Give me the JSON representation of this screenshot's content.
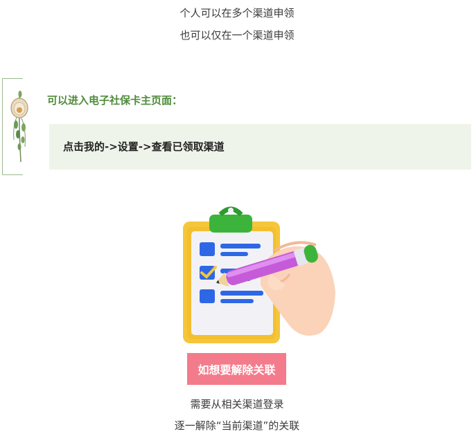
{
  "intro": {
    "line1": "个人可以在多个渠道申领",
    "line2": "也可以仅在一个渠道申领"
  },
  "section": {
    "title": "可以进入电子社保卡主页面：",
    "tip": "点击我的->设置->查看已领取渠道"
  },
  "cta": {
    "label": "如想要解除关联"
  },
  "footer": {
    "line1": "需要从相关渠道登录",
    "line2": "逐一解除“当前渠道”的关联"
  },
  "colors": {
    "accent_green": "#4f8b3b",
    "tip_background": "#eef4ea",
    "badge_pink": "#f47b8b"
  },
  "icons": {
    "decoration": "herb-bundle-icon",
    "illustration": "clipboard-checklist-icon"
  }
}
